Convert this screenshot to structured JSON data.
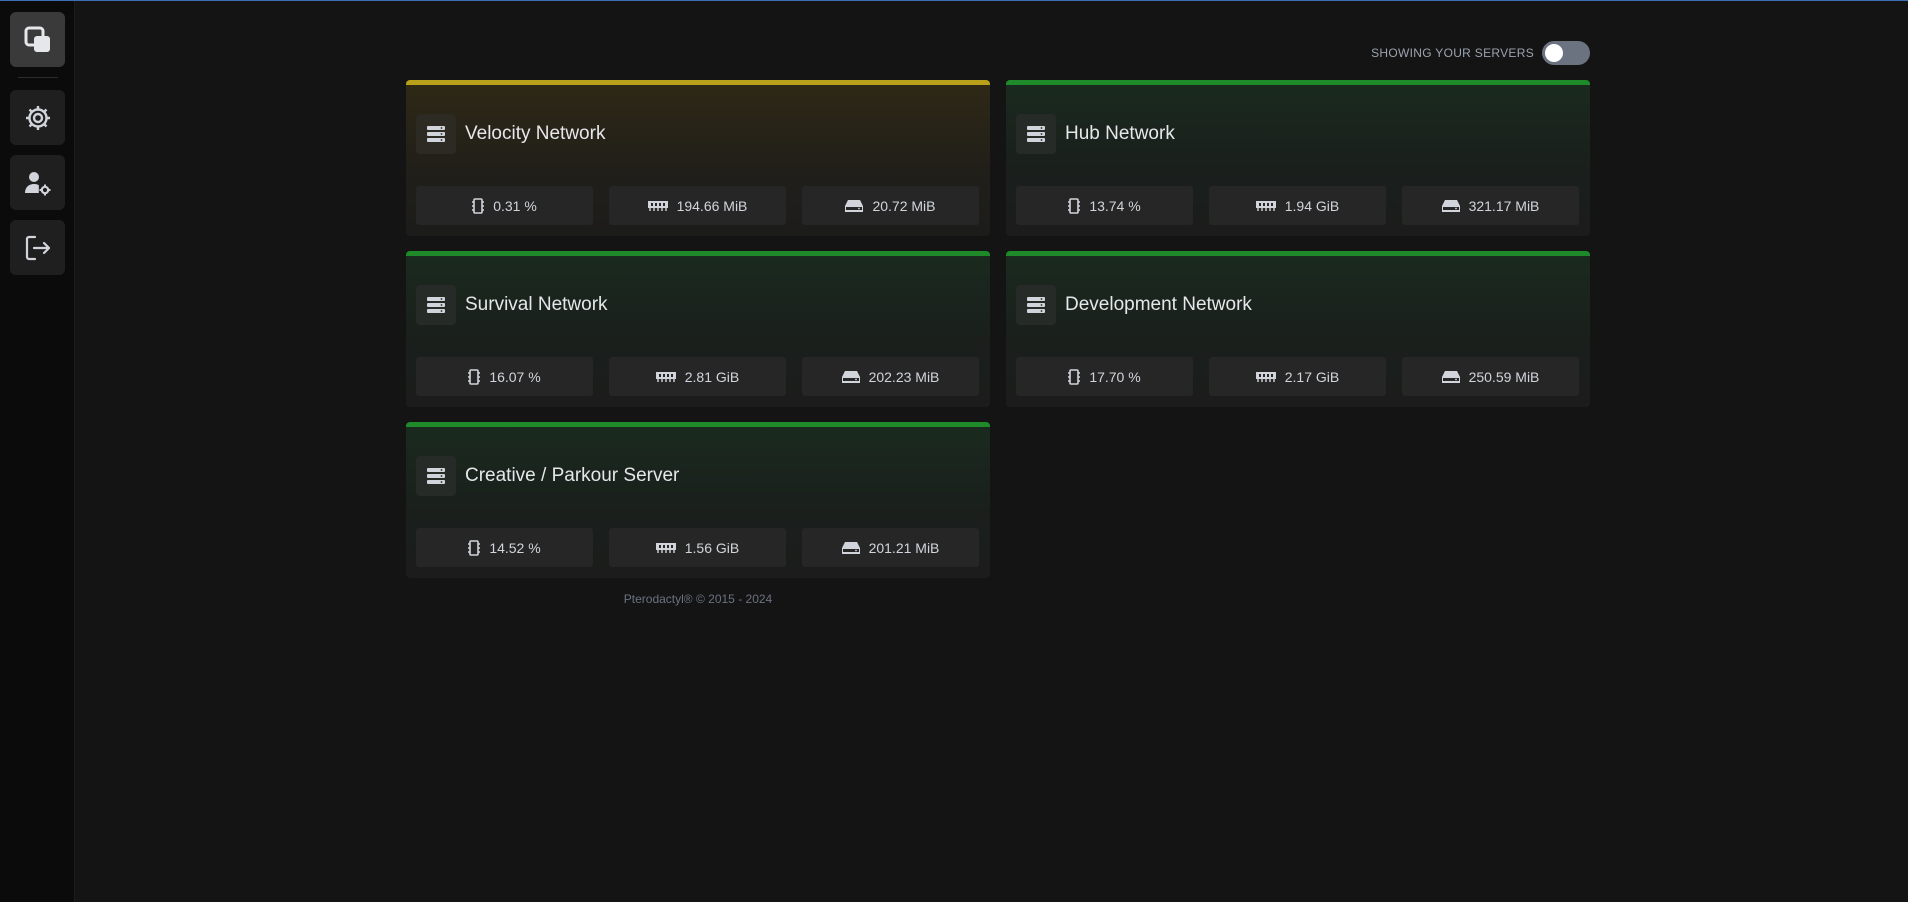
{
  "toggle": {
    "label": "SHOWING YOUR SERVERS",
    "on": false
  },
  "sidebar": {
    "items": [
      {
        "icon": "app-logo-icon"
      },
      {
        "icon": "gear-icon"
      },
      {
        "icon": "user-cog-icon"
      },
      {
        "icon": "logout-icon"
      }
    ]
  },
  "servers": [
    {
      "name": "Velocity Network",
      "status_color": "#b8a01a",
      "cpu": "0.31 %",
      "memory": "194.66 MiB",
      "disk": "20.72 MiB"
    },
    {
      "name": "Hub Network",
      "status_color": "#1f8a2a",
      "cpu": "13.74 %",
      "memory": "1.94 GiB",
      "disk": "321.17 MiB"
    },
    {
      "name": "Survival Network",
      "status_color": "#1f8a2a",
      "cpu": "16.07 %",
      "memory": "2.81 GiB",
      "disk": "202.23 MiB"
    },
    {
      "name": "Development Network",
      "status_color": "#1f8a2a",
      "cpu": "17.70 %",
      "memory": "2.17 GiB",
      "disk": "250.59 MiB"
    },
    {
      "name": "Creative / Parkour Server",
      "status_color": "#1f8a2a",
      "cpu": "14.52 %",
      "memory": "1.56 GiB",
      "disk": "201.21 MiB"
    }
  ],
  "footer": {
    "text": "Pterodactyl® © 2015 - 2024"
  }
}
